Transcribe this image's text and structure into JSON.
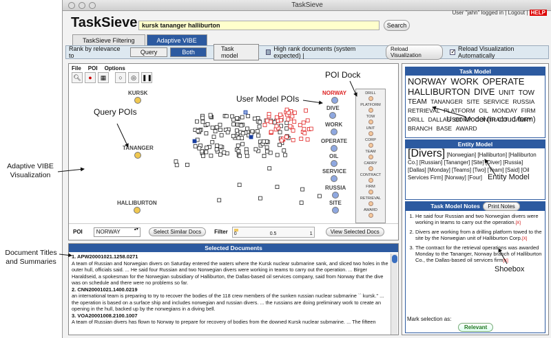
{
  "window": {
    "title": "TaskSieve",
    "app_name": "TaskSieve"
  },
  "header": {
    "search_value": "kursk tananger halliburton",
    "search_button": "Search",
    "user_line": "User \"jahn\" logged in | Logout |",
    "help": "HELP"
  },
  "tabs": [
    {
      "label": "TaskSieve Filtering"
    },
    {
      "label": "Adaptive VIBE"
    }
  ],
  "rankbar": {
    "label": "Rank by relevance to",
    "options": [
      "Query",
      "Both",
      "Task model"
    ],
    "high_rank_label": "High rank documents (system expected) |",
    "reload_button": "Reload Visualization",
    "reload_auto_label": "Reload Visualization Automatically"
  },
  "viz": {
    "menus": [
      "File",
      "POI",
      "Options"
    ],
    "query_pois": [
      "KURSK",
      "TANANGER",
      "HALLIBURTON"
    ],
    "user_pois": [
      "NORWAY",
      "DIVE",
      "WORK",
      "OPERATE",
      "OIL",
      "SERVICE",
      "RUSSIA",
      "SITE"
    ],
    "dock_items": [
      "DRILL",
      "PLATFORM",
      "TOW",
      "UNIT",
      "CORP",
      "TEAM",
      "CARRY",
      "CONTRACT",
      "FIRM",
      "RETRIEVAL",
      "AWARD"
    ],
    "poi_label": "POI",
    "poi_selected": "NORWAY",
    "similar_button": "Select Similar Docs",
    "filter_label": "Filter",
    "filter_ticks": [
      "0",
      "0.5",
      "1"
    ],
    "filter_value": 0.05,
    "view_selected_button": "View Selected Docs"
  },
  "selected_docs": {
    "title": "Selected Documents",
    "docs": [
      {
        "id": "1. APW20001021.1258.0271",
        "text": "A team of Russian and Norwegian divers on Saturday entered the waters where the Kursk nuclear submarine sank, and sliced two holes in the outer hull, officials said. ... He said four Russian and two Norwegian divers were working in teams to carry out the operation. ... Birger Haraldseid, a spokesman for the Norwegian subsidiary of Halliburton, the Dallas-based oil services company, said from Norway that the dive was on schedule and there were no problems so far."
      },
      {
        "id": "2. CNN20001021.1400.0219",
        "text": "an international team is preparing to try to recover the bodies of the 118 crew members of the sunken russian nuclear submarine `` kursk.'' ... the operation is based on a surface ship and includes norwegian and russian divers. ... the russians are doing preliminary work to create an opening in the hull, backed up by the norwegians in a diving bell."
      },
      {
        "id": "3. VOA20001008.2100.1007",
        "text": "A team of Russian divers has flown to Norway to prepare for recovery of bodies from the downed Kursk nuclear submarine. ... The fifteen"
      }
    ]
  },
  "task_model": {
    "title": "Task Model",
    "words": [
      {
        "w": "NORWAY",
        "s": 3
      },
      {
        "w": "WORK",
        "s": 3
      },
      {
        "w": "OPERATE",
        "s": 3
      },
      {
        "w": "HALLIBURTON",
        "s": 3
      },
      {
        "w": "DIVE",
        "s": 3
      },
      {
        "w": "UNIT",
        "s": 2
      },
      {
        "w": "TOW",
        "s": 2
      },
      {
        "w": "TEAM",
        "s": 2
      },
      {
        "w": "TANANGER",
        "s": 1
      },
      {
        "w": "SITE",
        "s": 1
      },
      {
        "w": "SERVICE",
        "s": 1
      },
      {
        "w": "RUSSIA",
        "s": 1
      },
      {
        "w": "RETRIEVAL",
        "s": 1
      },
      {
        "w": "PLATFORM",
        "s": 1
      },
      {
        "w": "OIL",
        "s": 1
      },
      {
        "w": "MONDAY",
        "s": 1
      },
      {
        "w": "FIRM",
        "s": 1
      },
      {
        "w": "DRILL",
        "s": 1
      },
      {
        "w": "DALLAS",
        "s": 1
      },
      {
        "w": "CORP",
        "s": 1
      },
      {
        "w": "CONTRACT",
        "s": 1
      },
      {
        "w": "CARRY",
        "s": 1
      },
      {
        "w": "BRANCH",
        "s": 1
      },
      {
        "w": "BASE",
        "s": 1
      },
      {
        "w": "AWARD",
        "s": 1
      }
    ]
  },
  "entity_model": {
    "title": "Entity Model",
    "big": "[Divers]",
    "rest": "[Norwegian] [Halliburton] [Halliburton Co.] [Russian] [Tananger] [Site] [Diver] [Russia] [Dallas] [Monday] [Teams] [Two] [Team] [Said] [Oil Services Firm] [Norway] [Four]"
  },
  "notes": {
    "title": "Task Model Notes",
    "print_button": "Print Notes",
    "items": [
      "He said four Russian and two Norwegian divers were working in teams to carry out the operation.",
      "Divers are working from a drilling platform towed to the site by the Norwegian unit of Halliburton Corp.",
      "The contract for the retrieval operations was awarded Monday to the Tananger, Norway branch of Halliburton Co., the Dallas-based oil services firm"
    ],
    "remove_mark": "[X]",
    "mark_label": "Mark selection as:",
    "relevant_button": "Relevant"
  },
  "annotations": {
    "adaptive_vibe": "Adaptive VIBE Visualization",
    "doc_titles": "Document Titles and Summaries",
    "poi_dock": "POI Dock",
    "user_model_pois": "User Model POIs",
    "query_pois": "Query POIs",
    "user_model": "User Model (in cloud form)",
    "entity_model": "Entity Model",
    "shoebox": "Shoebox"
  },
  "colors": {
    "accent": "#2c5aa0",
    "query_poi": "#f0c850",
    "user_poi": "#8fa8e0",
    "dock_poi": "#f4c89c"
  }
}
